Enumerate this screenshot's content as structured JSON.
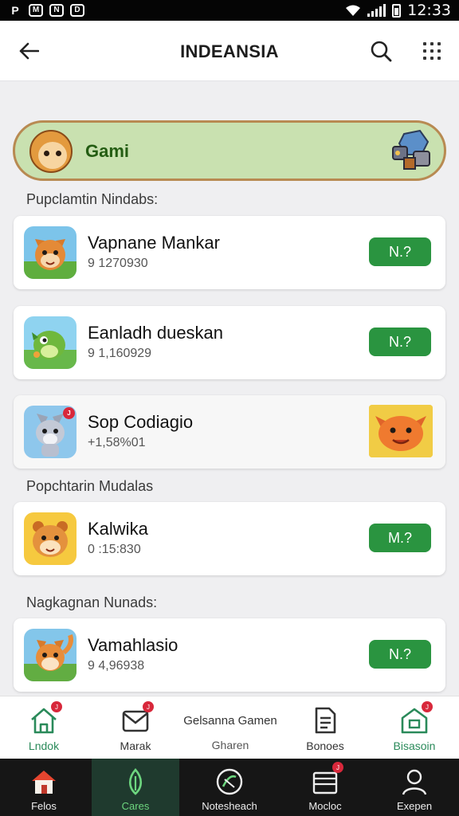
{
  "status_bar": {
    "left_glyphs": [
      "P",
      "M",
      "N",
      "D"
    ],
    "time": "12:33"
  },
  "app_bar": {
    "title": "INDEANSIA"
  },
  "banner": {
    "label": "Gami"
  },
  "sections": [
    {
      "label": "Pupclamtin Nindabs:"
    },
    {
      "label": "Popchtarin Mudalas"
    },
    {
      "label": "Nagkagnan Nunads:"
    }
  ],
  "apps": [
    {
      "name": "Vapnane Mankar",
      "sub": "9 1270930",
      "button": "N.?"
    },
    {
      "name": "Eanladh dueskan",
      "sub": "9 1,160929",
      "button": "N.?"
    },
    {
      "name": "Sop Codiagio",
      "sub": "+1,58%01",
      "badge": "J"
    },
    {
      "name": "Kalwika",
      "sub": "0 :15:830",
      "button": "M.?"
    },
    {
      "name": "Vamahlasio",
      "sub": "9 4,96938",
      "button": "N.?"
    }
  ],
  "nav_top": {
    "items": [
      {
        "label": "Lndok",
        "badge": "J"
      },
      {
        "label": "Marak",
        "badge": "J"
      },
      {
        "label": "Bonoes"
      },
      {
        "label": "Bisasoin",
        "badge": "J"
      }
    ],
    "center_title": "Gelsanna Gamen",
    "center_sub": "Gharen"
  },
  "nav_bottom": {
    "items": [
      {
        "label": "Felos"
      },
      {
        "label": "Cares"
      },
      {
        "label": "Notesheach"
      },
      {
        "label": "Mocloc",
        "badge": "J"
      },
      {
        "label": "Exepen"
      }
    ]
  },
  "colors": {
    "accent_green": "#2a9440",
    "banner_bg": "#c9e1b0",
    "banner_border": "#b88a52",
    "badge_red": "#d8283b",
    "nav_dark": "#161616"
  }
}
